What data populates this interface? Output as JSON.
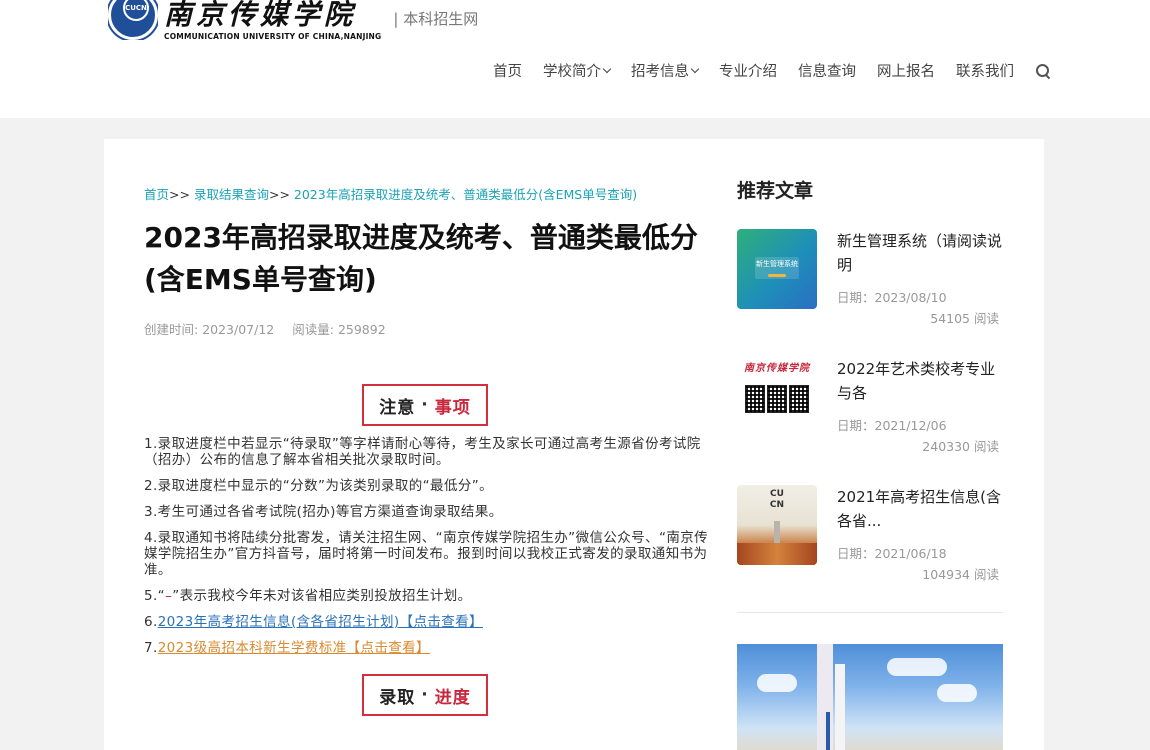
{
  "header": {
    "logo_cn": "南京传媒学院",
    "logo_en": "COMMUNICATION UNIVERSITY OF CHINA,NANJING",
    "seal_text": "CUCN",
    "site_name": "| 本科招生网",
    "nav": [
      {
        "label": "首页",
        "has_dropdown": false
      },
      {
        "label": "学校简介",
        "has_dropdown": true
      },
      {
        "label": "招考信息",
        "has_dropdown": true
      },
      {
        "label": "专业介绍",
        "has_dropdown": false
      },
      {
        "label": "信息查询",
        "has_dropdown": false
      },
      {
        "label": "网上报名",
        "has_dropdown": false
      },
      {
        "label": "联系我们",
        "has_dropdown": false
      }
    ]
  },
  "article": {
    "breadcrumb": {
      "home": "首页",
      "sep": ">>",
      "category": "录取结果查询",
      "current": "2023年高招录取进度及统考、普通类最低分(含EMS单号查询)"
    },
    "title": "2023年高招录取进度及统考、普通类最低分(含EMS单号查询)",
    "meta": {
      "created_label": "创建时间:",
      "created_value": "2023/07/12",
      "reads_label": "阅读量:",
      "reads_value": "259892"
    },
    "notice_box": {
      "left": "注意",
      "dot": "·",
      "right": "事项"
    },
    "notes": [
      "1.录取进度栏中若显示“待录取”等字样请耐心等待，考生及家长可通过高考生源省份考试院（招办）公布的信息了解本省相关批次录取时间。",
      "2.录取进度栏中显示的“分数”为该类别录取的“最低分”。",
      "3.考生可通过各省考试院(招办)等官方渠道查询录取结果。",
      "4.录取通知书将陆续分批寄发，请关注招生网、“南京传媒学院招生办”微信公众号、“南京传媒学院招生办”官方抖音号，届时将第一时间发布。报到时间以我校正式寄发的录取通知书为准。"
    ],
    "note5": {
      "prefix": "5.“",
      "dash": "–",
      "suffix": "”表示我校今年未对该省相应类别投放招生计划。"
    },
    "note6": {
      "num": "6.",
      "link": "2023年高考招生信息(含各省招生计划)【点击查看】"
    },
    "note7": {
      "num": "7.",
      "link": "2023级高招本科新生学费标准【点击查看】"
    },
    "admission_box": {
      "left": "录取",
      "dot": "·",
      "right": "进度"
    }
  },
  "sidebar": {
    "title": "推荐文章",
    "items": [
      {
        "title": "新生管理系统（请阅读说明",
        "date": "日期：2023/08/10",
        "reads": "54105 阅读",
        "thumb_text": "新生管理系统"
      },
      {
        "title": "2022年艺术类校考专业与各",
        "date": "日期：2021/12/06",
        "reads": "240330 阅读",
        "thumb_text": "南京传媒学院"
      },
      {
        "title": "2021年高考招生信息(含各省...",
        "date": "日期：2021/06/18",
        "reads": "104934 阅读",
        "thumb_text": "CU\nCN"
      }
    ]
  }
}
